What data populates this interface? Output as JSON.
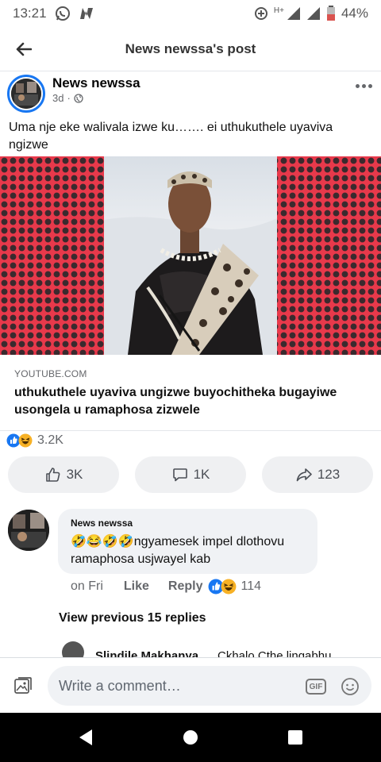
{
  "status_bar": {
    "time": "13:21",
    "network": "H+",
    "battery": "44%",
    "icons": [
      "whatsapp-icon",
      "n-app-icon",
      "data-saver-icon",
      "signal-icon",
      "battery-icon"
    ]
  },
  "header": {
    "title": "News newssa's post",
    "back_icon": "arrow-left-icon"
  },
  "post": {
    "author": "News newssa",
    "age": "3d",
    "separator": "·",
    "audience_icon": "globe-icon",
    "text": "Uma nje eke walivala izwe ku……. ei uthukuthele uyaviva ngizwe",
    "link": {
      "domain": "YOUTUBE.COM",
      "title": "uthukuthele uyaviva ungizwe buyochitheka bugayiwe usongela u ramaphosa zizwele"
    },
    "reactions": {
      "count": "3.2K",
      "types": [
        "like-icon",
        "haha-icon"
      ]
    },
    "actions": [
      {
        "name": "like-button",
        "icon": "thumbs-up-icon",
        "label": "3K"
      },
      {
        "name": "comment-button",
        "icon": "comment-icon",
        "label": "1K"
      },
      {
        "name": "share-button",
        "icon": "share-icon",
        "label": "123"
      }
    ]
  },
  "comment": {
    "author": "News newssa",
    "emojis": "🤣😂🤣🤣",
    "text": "ngyamesek impel dlothovu ramaphosa usjwayel kab",
    "time": "on Fri",
    "like_label": "Like",
    "reply_label": "Reply",
    "reaction_count": "114",
    "view_previous": "View previous 15 replies",
    "reply_peek": {
      "author": "Slindile Makhanya",
      "text": "Ckhalo Cthe lingabhu"
    }
  },
  "composer": {
    "placeholder": "Write a comment…",
    "gif_label": "GIF"
  },
  "colors": {
    "accent": "#1877f2",
    "banner_red": "#e8394b",
    "muted_text": "#65676b",
    "bubble_bg": "#f0f2f5"
  }
}
